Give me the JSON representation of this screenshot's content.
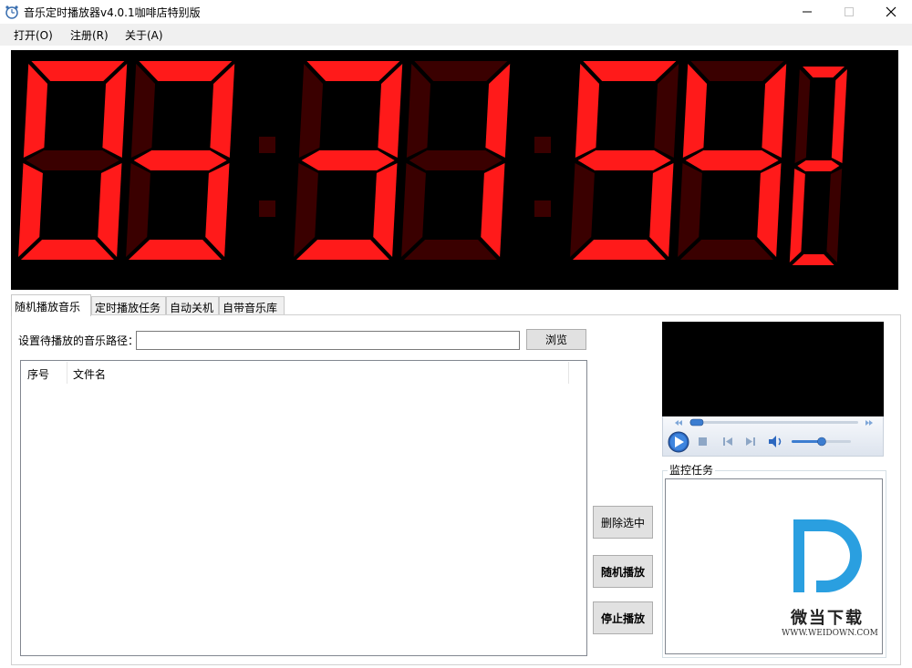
{
  "window": {
    "title": "音乐定时播放器v4.0.1咖啡店特别版"
  },
  "menu": [
    {
      "label": "打开(O)"
    },
    {
      "label": "注册(R)"
    },
    {
      "label": "关于(A)"
    }
  ],
  "clock": {
    "time": "03:31:54",
    "seconds_tenths": "2",
    "color_on": "#ff1a1a",
    "color_off": "#3a0000"
  },
  "tabs": [
    {
      "label": "随机播放音乐",
      "active": true
    },
    {
      "label": "定时播放任务",
      "active": false
    },
    {
      "label": "自动关机",
      "active": false
    },
    {
      "label": "自带音乐库",
      "active": false
    }
  ],
  "random_play": {
    "path_label": "设置待播放的音乐路径：",
    "path_value": "",
    "browse_label": "浏览",
    "list_columns": [
      "序号",
      "文件名"
    ],
    "delete_label": "删除选中",
    "random_label": "随机播放",
    "stop_label": "停止播放"
  },
  "monitor": {
    "title": "监控任务"
  },
  "watermark": {
    "name": "微当下载",
    "url": "WWW.WEIDOWN.COM",
    "color": "#2a9fe0"
  }
}
